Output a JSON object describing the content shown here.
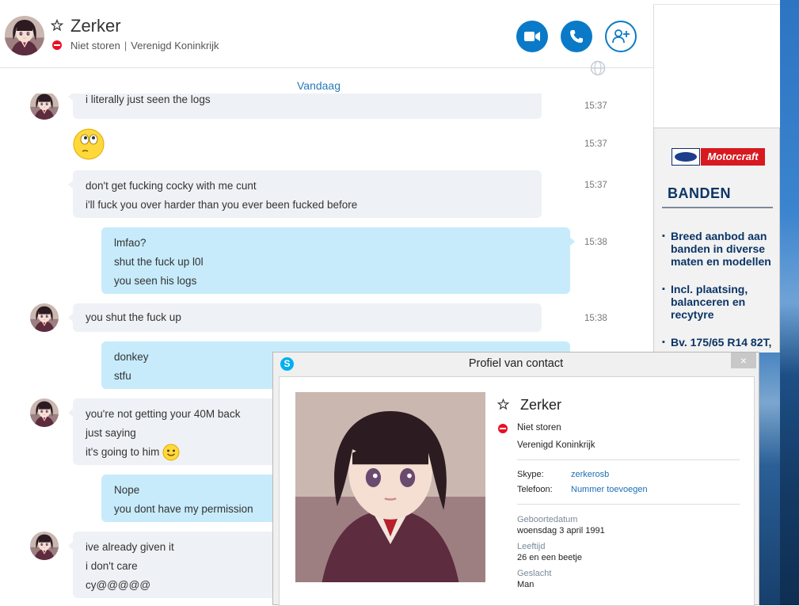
{
  "header": {
    "name": "Zerker",
    "status": "Niet storen",
    "location": "Verenigd Koninkrijk",
    "icons": {
      "video": "video-call-icon",
      "call": "phone-icon",
      "add": "add-contact-icon"
    }
  },
  "chat": {
    "date_label": "Vandaag",
    "messages": [
      {
        "dir": "in",
        "lines": [
          "i literally just seen the logs"
        ],
        "time": "15:37"
      },
      {
        "dir": "in",
        "emoji": "thinking-emoji",
        "time": "15:37"
      },
      {
        "dir": "in",
        "lines": [
          "don't get fucking cocky with me cunt",
          "i'll fuck you over harder than you ever been fucked before"
        ],
        "time": "15:37"
      },
      {
        "dir": "out",
        "lines": [
          "lmfao?",
          "shut the fuck up l0l",
          "you seen his logs"
        ],
        "time": "15:38"
      },
      {
        "dir": "in",
        "lines": [
          "you shut the fuck up"
        ],
        "time": "15:38"
      },
      {
        "dir": "out",
        "lines": [
          "donkey",
          "stfu"
        ]
      },
      {
        "dir": "in",
        "lines": [
          "you're not getting your 40M back",
          "just saying",
          "it's going to him"
        ]
      },
      {
        "dir": "out",
        "lines": [
          "Nope",
          "you dont have my permission"
        ]
      },
      {
        "dir": "in",
        "lines": [
          "ive already given it",
          "i don't care",
          "cy@@@@@"
        ]
      }
    ]
  },
  "ad": {
    "brand": "Motorcraft",
    "title": "BANDEN",
    "items": [
      "Breed aanbod aan banden in diverse maten en modellen",
      "Incl. plaatsing, balanceren en recytyre",
      "Bv. 175/65 R14 82T,"
    ]
  },
  "dialog": {
    "title": "Profiel van contact",
    "close_label": "×",
    "name": "Zerker",
    "status": "Niet storen",
    "location": "Verenigd Koninkrijk",
    "skype_label": "Skype:",
    "skype_value": "zerkerosb",
    "phone_label": "Telefoon:",
    "phone_value": "Nummer toevoegen",
    "birthday_label": "Geboortedatum",
    "birthday_value": "woensdag 3 april 1991",
    "age_label": "Leeftijd",
    "age_value": "26 en een beetje",
    "gender_label": "Geslacht",
    "gender_value": "Man"
  },
  "colors": {
    "accent": "#0a7ac8",
    "bubble_out": "#c7ebfb",
    "bubble_in": "#eef1f5",
    "status_red": "#e81123"
  }
}
